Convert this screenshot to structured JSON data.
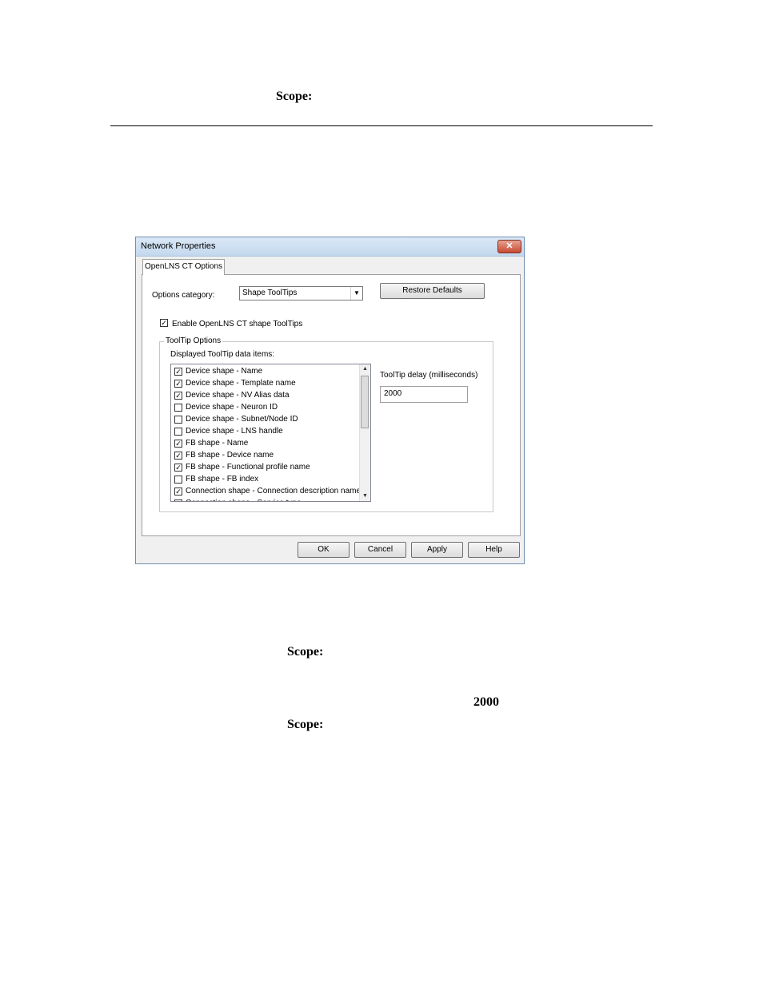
{
  "doc": {
    "scope_label_1": "Scope:",
    "scope_label_2": "Scope:",
    "value_2000": "2000",
    "scope_label_3": "Scope:"
  },
  "dialog": {
    "title": "Network Properties",
    "close_glyph": "✕",
    "tab_label": "OpenLNS CT Options",
    "options_category_label": "Options category:",
    "options_category_value": "Shape ToolTips",
    "restore_defaults_label": "Restore Defaults",
    "enable_tooltips_label": "Enable OpenLNS CT shape ToolTips",
    "enable_tooltips_checked": true,
    "group_title": "ToolTip Options",
    "displayed_items_label": "Displayed ToolTip data items:",
    "items": [
      {
        "label": "Device shape - Name",
        "checked": true
      },
      {
        "label": "Device shape - Template name",
        "checked": true
      },
      {
        "label": "Device shape - NV Alias data",
        "checked": true
      },
      {
        "label": "Device shape - Neuron ID",
        "checked": false
      },
      {
        "label": "Device shape - Subnet/Node ID",
        "checked": false
      },
      {
        "label": "Device shape - LNS handle",
        "checked": false
      },
      {
        "label": "FB shape - Name",
        "checked": true
      },
      {
        "label": "FB shape - Device name",
        "checked": true
      },
      {
        "label": "FB shape - Functional profile name",
        "checked": true
      },
      {
        "label": "FB shape - FB index",
        "checked": false
      },
      {
        "label": "Connection shape - Connection description name",
        "checked": true
      },
      {
        "label": "Connection shape - Service type",
        "checked": true
      }
    ],
    "delay_label": "ToolTip delay (milliseconds)",
    "delay_value": "2000",
    "ok_label": "OK",
    "cancel_label": "Cancel",
    "apply_label": "Apply",
    "help_label": "Help"
  }
}
